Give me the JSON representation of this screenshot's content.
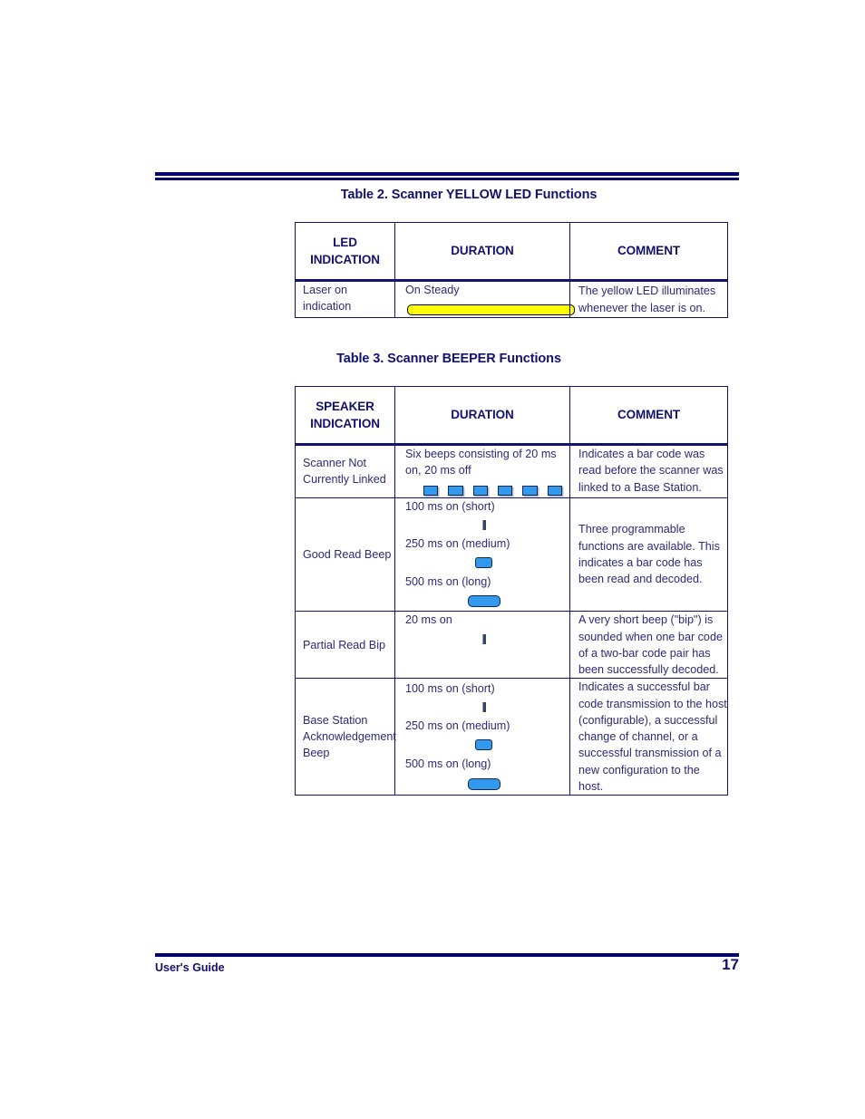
{
  "document": {
    "footer_left": "User's Guide",
    "page_number": "17"
  },
  "colors": {
    "navy_rule": "#00006b",
    "heading_text": "#12126e",
    "body_text": "#2a2a7a",
    "beep_blue": "#3399ee",
    "led_yellow": "#ffff00"
  },
  "table2": {
    "caption": "Table 2. Scanner YELLOW LED Functions",
    "headers": [
      "LED INDICATION",
      "DURATION",
      "COMMENT"
    ],
    "header_line1": "LED",
    "header_line2": "INDICATION",
    "header_duration": "DURATION",
    "header_comment": "COMMENT",
    "rows": [
      {
        "indication": "Laser on indication",
        "duration_text": "On Steady",
        "indicator": "yellow-bar-steady",
        "comment": "The yellow LED illuminates whenever the laser is on."
      }
    ]
  },
  "table3": {
    "caption": "Table 3. Scanner BEEPER Functions",
    "headers": [
      "SPEAKER INDICATION",
      "DURATION",
      "COMMENT"
    ],
    "header_line1": "SPEAKER",
    "header_line2": "INDICATION",
    "header_duration": "DURATION",
    "header_comment": "COMMENT",
    "rows": [
      {
        "indication": "Scanner Not Currently Linked",
        "duration_text": "Six beeps consisting of 20 ms on, 20 ms off",
        "indicator": "six-short-beeps",
        "beep_count": 6,
        "comment": "Indicates a bar code was read before the scanner was linked to a Base Station."
      },
      {
        "indication": "Good Read Beep",
        "duration_short": "100 ms on (short)",
        "duration_medium": "250 ms on (medium)",
        "duration_long": "500 ms on (long)",
        "comment": "Three programmable functions are available. This indicates a bar code has been read and decoded."
      },
      {
        "indication": "Partial Read Bip",
        "duration_text": "20 ms on",
        "indicator": "single-tick",
        "comment": "A very short beep (\"bip\") is sounded when one bar code of a two-bar code pair has been successfully decoded."
      },
      {
        "indication": "Base Station Acknowledgement Beep",
        "duration_short": "100 ms on (short)",
        "duration_medium": "250 ms on (medium)",
        "duration_long": "500 ms on (long)",
        "comment": "Indicates a successful bar code transmission to the host (configurable), a successful change of channel, or a successful transmission of a new configuration to the host."
      }
    ]
  }
}
